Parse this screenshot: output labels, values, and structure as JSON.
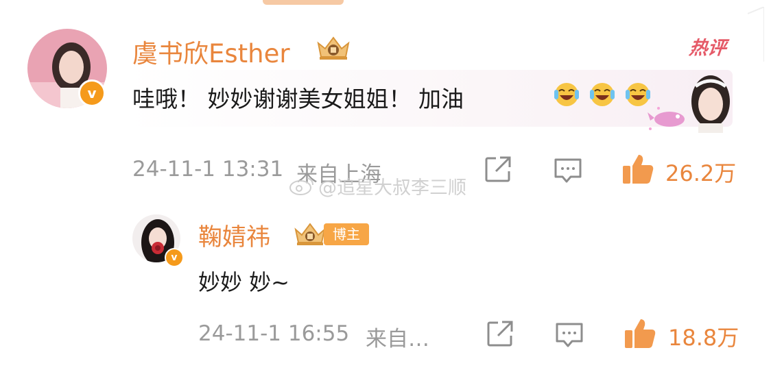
{
  "comment": {
    "username": "虞书欣Esther",
    "hot_tag": "热评",
    "text": "哇哦！ 妙妙谢谢美女姐姐！ 加油",
    "emoji_icons": [
      "laugh-cry-emoji",
      "laugh-cry-emoji",
      "laugh-cry-emoji"
    ],
    "timestamp": "24-11-1 13:31",
    "location": "来自上海",
    "like_count": "26.2万"
  },
  "reply": {
    "username": "鞠婧祎",
    "badge": "博主",
    "text": "妙妙 妙~",
    "timestamp": "24-11-1 16:55",
    "location": "来自…",
    "like_count": "18.8万"
  },
  "watermark": "@追星大叔李三顺",
  "colors": {
    "accent": "#e9863d",
    "hot": "#e55a68",
    "verified": "#f59a1b",
    "meta": "#9a9a9a",
    "text": "#1a1a1a"
  }
}
